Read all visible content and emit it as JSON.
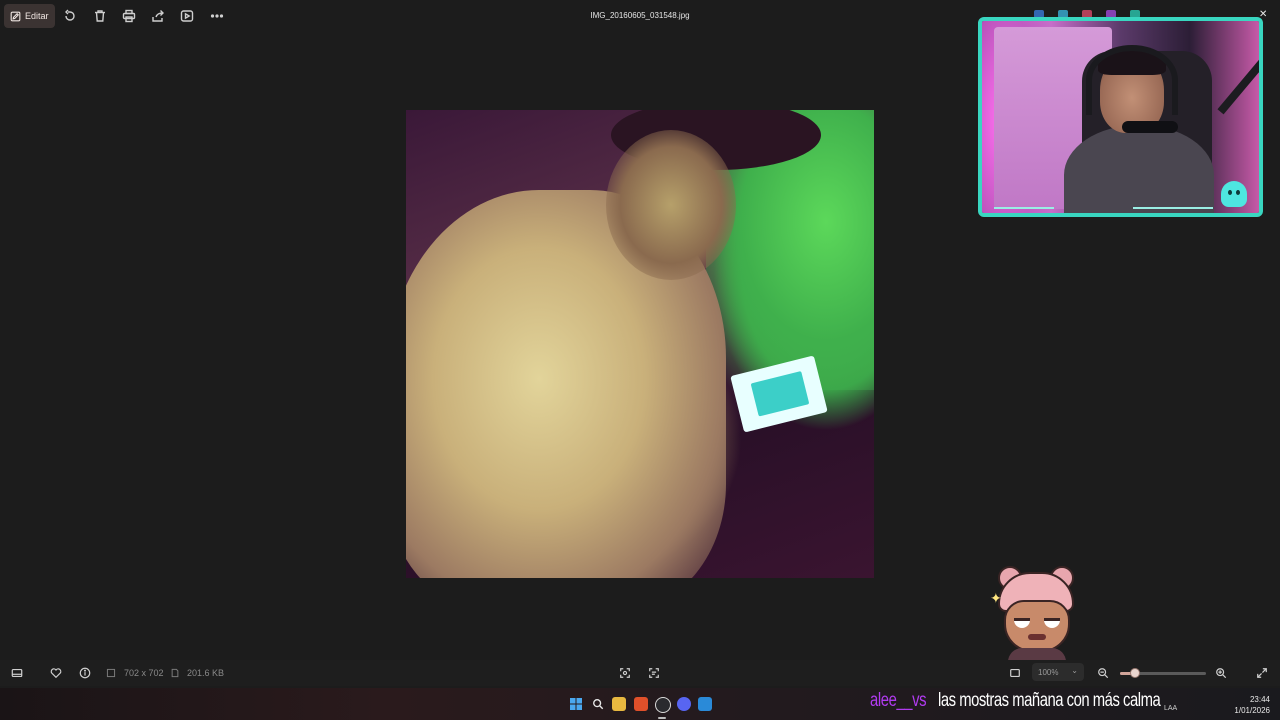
{
  "toolbar": {
    "edit_label": "Editar",
    "file_name": "IMG_20160605_031548.jpg",
    "icons": [
      "pencil-icon",
      "rotate-icon",
      "delete-icon",
      "print-icon",
      "share-icon",
      "slideshow-icon",
      "more-icon"
    ]
  },
  "status_bar": {
    "dimensions": "702 x 702",
    "file_size": "201.6 KB",
    "zoom_level": "100%",
    "zoom_slider_value": 0.18
  },
  "chat_overlay": {
    "username": "alee__vs",
    "message": "las mostras mañana con más calma"
  },
  "taskbar": {
    "time": "23:44",
    "date": "1/01/2026",
    "language": "LAA",
    "icons": [
      "windows-start-icon",
      "search-icon",
      "file-explorer-icon",
      "brave-icon",
      "obs-icon",
      "discord-icon",
      "photos-icon"
    ]
  },
  "colors": {
    "background": "#1c1c1c",
    "accent": "#d1a59a",
    "cam_border": "#39d6c0",
    "chat_username": "#b13bf0",
    "chat_message": "#ffffff"
  }
}
